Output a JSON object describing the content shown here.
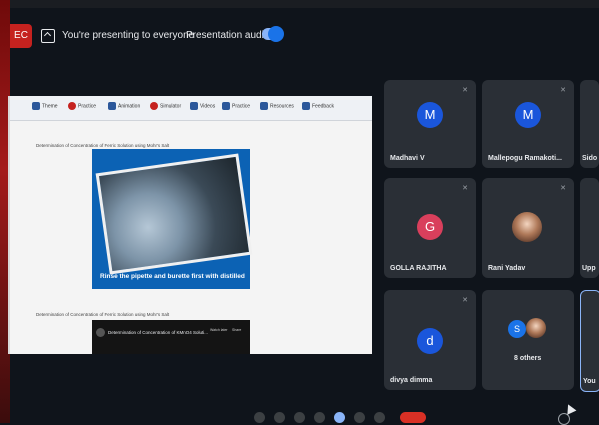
{
  "banner": {
    "host_chip": "EC",
    "presenting_text": "You're presenting to everyone",
    "audio_label": "Presentation audio",
    "audio_toggle_on": true,
    "accent_color": "#1a73e8"
  },
  "slide": {
    "ribbon": [
      "Theme",
      "Practice",
      "Animation",
      "Simulator",
      "Videos",
      "Practice",
      "Resources",
      "Feedback"
    ],
    "caption_top": "Determination of Concentration of Ferric Solution using Mohr's Salt",
    "photo_caption": "Rinse the pipette and burette first with distilled",
    "caption_bottom": "Determination of Concentration of Ferric Solution using Mohr's Salt",
    "video_title": "Determination of Concentration of KMnO4 Soluti...",
    "video_watch": "Watch later",
    "video_share": "Share"
  },
  "participants": [
    {
      "name": "Madhavi V",
      "initial": "M",
      "avatar_color": "#1a56db"
    },
    {
      "name": "Mallepogu Ramakoti...",
      "initial": "M",
      "avatar_color": "#1a56db"
    },
    {
      "name": "Sido",
      "initial": "",
      "avatar_color": "#2a2f36"
    },
    {
      "name": "GOLLA RAJITHA",
      "initial": "G",
      "avatar_color": "#d93f5c"
    },
    {
      "name": "Rani Yadav",
      "initial": "",
      "avatar_color": "#2a2f36"
    },
    {
      "name": "Upp",
      "initial": "",
      "avatar_color": "#2a2f36"
    },
    {
      "name": "divya dimma",
      "initial": "d",
      "avatar_color": "#1a56db"
    },
    {
      "name": "8 others",
      "initial": "S",
      "avatar_color": "#1a73e8"
    },
    {
      "name": "You",
      "initial": "",
      "avatar_color": "#2a2f36"
    }
  ],
  "icons": {
    "present": "present-to-all-icon",
    "mic_off": "mic-off-icon",
    "end_call": "end-call-icon"
  }
}
